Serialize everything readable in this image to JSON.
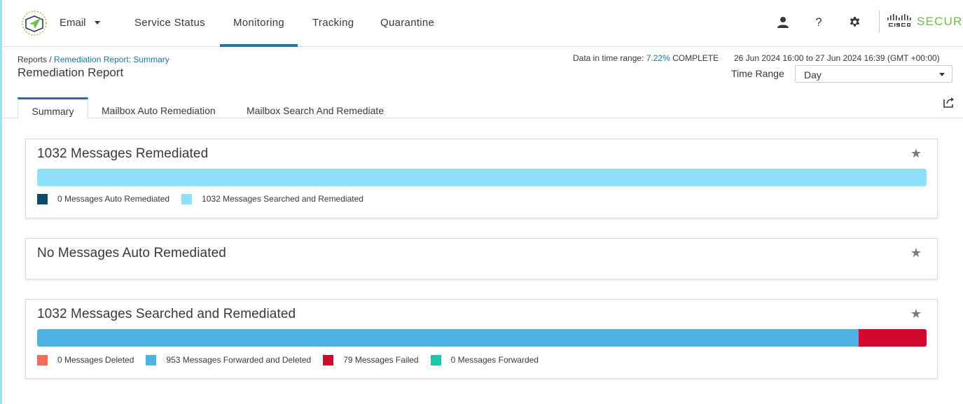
{
  "nav": {
    "product": "Email",
    "items": [
      "Service Status",
      "Monitoring",
      "Tracking",
      "Quarantine"
    ],
    "active": "Monitoring",
    "brand_secure": "SECURE",
    "icons": [
      "user-icon",
      "help-icon",
      "gear-icon"
    ]
  },
  "header": {
    "breadcrumb_root": "Reports /",
    "breadcrumb_current": "Remediation Report: Summary",
    "title": "Remediation Report",
    "dtr_label": "Data in time range:",
    "dtr_pct": "7.22%",
    "dtr_status": "COMPLETE",
    "date_range": "26 Jun 2024 16:00 to 27 Jun 2024 16:39 (GMT +00:00)",
    "time_range_label": "Time Range",
    "time_range_value": "Day"
  },
  "tabs": [
    "Summary",
    "Mailbox Auto Remediation",
    "Mailbox Search And Remediate"
  ],
  "cards": {
    "summary": {
      "title": "1032 Messages Remediated",
      "total": 1032,
      "segments": [
        {
          "label": "0 Messages Auto Remediated",
          "value": 0,
          "color": "#0d4a6b"
        },
        {
          "label": "1032 Messages Searched and Remediated",
          "value": 1032,
          "color": "#8ee1f8"
        }
      ]
    },
    "auto": {
      "title": "No Messages Auto Remediated"
    },
    "search": {
      "title": "1032 Messages Searched and Remediated",
      "total": 1032,
      "segments": [
        {
          "label": "0 Messages Deleted",
          "value": 0,
          "color": "#f26b5b"
        },
        {
          "label": "953 Messages Forwarded and Deleted",
          "value": 953,
          "color": "#4fb2e0"
        },
        {
          "label": "79 Messages Failed",
          "value": 79,
          "color": "#cf0a2c"
        },
        {
          "label": "0 Messages Forwarded",
          "value": 0,
          "color": "#19c8a8"
        }
      ]
    }
  }
}
